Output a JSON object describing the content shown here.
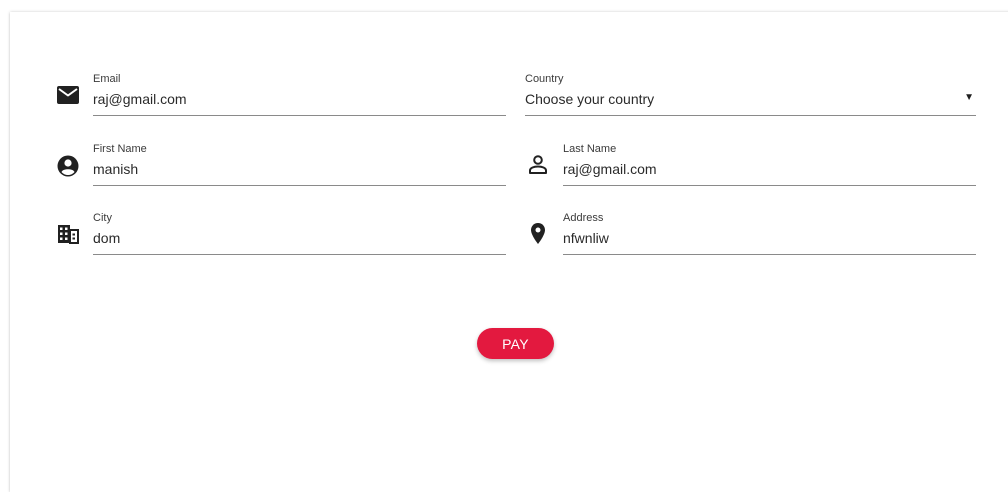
{
  "form": {
    "email": {
      "label": "Email",
      "value": "raj@gmail.com",
      "icon": "mail-icon"
    },
    "country": {
      "label": "Country",
      "value": "Choose your country",
      "caret": "▼"
    },
    "first_name": {
      "label": "First Name",
      "value": "manish",
      "icon": "account-circle-icon"
    },
    "last_name": {
      "label": "Last Name",
      "value": "raj@gmail.com",
      "icon": "person-outline-icon"
    },
    "city": {
      "label": "City",
      "value": "dom",
      "icon": "building-icon"
    },
    "address": {
      "label": "Address",
      "value": "nfwnliw",
      "icon": "location-pin-icon"
    }
  },
  "actions": {
    "pay_label": "PAY"
  },
  "colors": {
    "accent": "#e3193f",
    "underline": "#8a8a8a",
    "icon": "#212121"
  }
}
